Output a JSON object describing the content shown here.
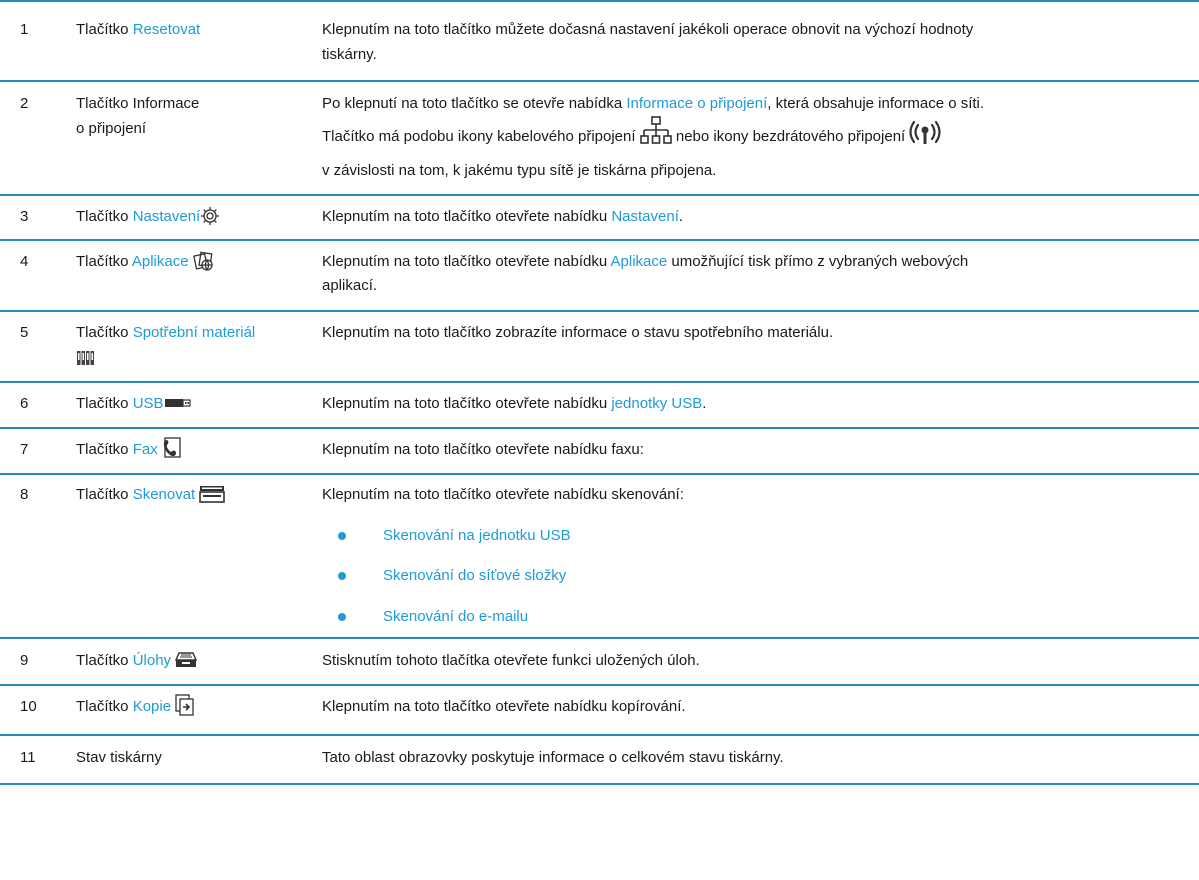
{
  "rows": [
    {
      "num": "1",
      "btn": "Tlačítko",
      "name": "Resetovat",
      "desc1": "Klepnutím na toto tlačítko můžete dočasná nastavení jakékoli operace obnovit na výchozí hodnoty",
      "desc2": "tiskárny."
    },
    {
      "num": "2",
      "name1": "Tlačítko Informace",
      "name2": "o připojení",
      "d1a": "Po klepnutí na toto tlačítko se otevře nabídka ",
      "d1link": "Informace o připojení",
      "d1b": ", která obsahuje informace o síti.",
      "d2a": "Tlačítko má podobu ikony kabelového připojení ",
      "d2b": " nebo ikony bezdrátového připojení ",
      "d3": "v závislosti na tom, k jakému typu sítě je tiskárna připojena.",
      "icon_wired": "wired-network-icon",
      "icon_wireless": "wireless-icon"
    },
    {
      "num": "3",
      "btn": "Tlačítko",
      "name": "Nastavení",
      "icon": "gear-icon",
      "da": "Klepnutím na toto tlačítko otevřete nabídku ",
      "dlink": "Nastavení",
      "db": "."
    },
    {
      "num": "4",
      "btn": "Tlačítko",
      "name": "Aplikace",
      "icon": "apps-icon",
      "da": "Klepnutím na toto tlačítko otevřete nabídku ",
      "dlink": "Aplikace",
      "db": " umožňující tisk přímo z vybraných webových",
      "desc2": "aplikací."
    },
    {
      "num": "5",
      "btn": "Tlačítko",
      "name": "Spotřební materiál",
      "icon": "supplies-icon",
      "desc": "Klepnutím na toto tlačítko zobrazíte informace o stavu spotřebního materiálu."
    },
    {
      "num": "6",
      "btn": "Tlačítko",
      "name": "USB",
      "icon": "usb-icon",
      "da": "Klepnutím na toto tlačítko otevřete nabídku ",
      "dlink": "jednotky USB",
      "db": "."
    },
    {
      "num": "7",
      "btn": "Tlačítko",
      "name": "Fax",
      "icon": "fax-icon",
      "desc": "Klepnutím na toto tlačítko otevřete nabídku faxu:"
    },
    {
      "num": "8",
      "btn": "Tlačítko",
      "name": "Skenovat",
      "icon": "scan-icon",
      "desc": "Klepnutím na toto tlačítko otevřete nabídku skenování:",
      "bullets": [
        "Skenování na jednotku USB",
        "Skenování do síťové složky",
        "Skenování do e-mailu"
      ]
    },
    {
      "num": "9",
      "btn": "Tlačítko",
      "name": "Úlohy",
      "icon": "jobs-icon",
      "desc": "Stisknutím tohoto tlačítka otevřete funkci uložených úloh."
    },
    {
      "num": "10",
      "btn": "Tlačítko",
      "name": "Kopie",
      "icon": "copy-icon",
      "desc": "Klepnutím na toto tlačítko otevřete nabídku kopírování."
    },
    {
      "num": "11",
      "name": "Stav tiskárny",
      "desc": "Tato oblast obrazovky poskytuje informace o celkovém stavu tiskárny."
    }
  ],
  "colors": {
    "accent": "#1f9bd7",
    "rule": "#2f86b8",
    "text": "#1a1a1a"
  }
}
